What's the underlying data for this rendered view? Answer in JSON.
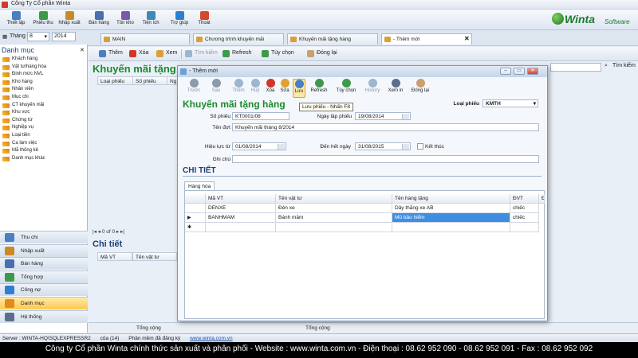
{
  "window": {
    "title": "Công Ty Cổ phần Winta"
  },
  "ribbon": {
    "buttons": [
      {
        "label": "Thiết lập",
        "icon": "settings-icon",
        "color": "#4a7fc1"
      },
      {
        "label": "Phiếu thu",
        "icon": "receipt-icon",
        "color": "#3e9a4a"
      },
      {
        "label": "Nhập xuất",
        "icon": "import-export-icon",
        "color": "#c98a26"
      },
      {
        "label": "Bán hàng",
        "icon": "sales-icon",
        "color": "#4a6fb0"
      },
      {
        "label": "Tồn kho",
        "icon": "warehouse-icon",
        "color": "#7a5aa8"
      },
      {
        "label": "Tiện ích",
        "icon": "utility-icon",
        "color": "#3a8bb8"
      },
      {
        "label": "Trợ giúp",
        "icon": "help-icon",
        "color": "#2f7fd1"
      },
      {
        "label": "Thoát",
        "icon": "exit-icon",
        "color": "#d2492e"
      }
    ],
    "logo": {
      "word": "Winta",
      "suffix": "Software"
    }
  },
  "period": {
    "month_label": "Tháng",
    "month_value": "8",
    "year_value": "2014"
  },
  "tabs": [
    {
      "label": "MAIN"
    },
    {
      "label": "Chương trình khuyến mãi"
    },
    {
      "label": "Khuyến mãi tặng hàng"
    },
    {
      "label": "- Thêm mới"
    }
  ],
  "sidebar": {
    "title": "Danh mục",
    "items": [
      "Khách hàng",
      "Vật tư/hàng hóa",
      "Định mức NVL",
      "Kho hàng",
      "Nhân viên",
      "Mục chi",
      "CT khuyến mãi",
      "Khu vực",
      "Chứng từ",
      "Nghiệp vụ",
      "Loại tiền",
      "Ca làm việc",
      "Mã thống kê",
      "Danh mục khác"
    ],
    "nav": [
      {
        "label": "Thu chi",
        "color": "#4a7fc1"
      },
      {
        "label": "Nhập xuất",
        "color": "#c98a26"
      },
      {
        "label": "Bán hàng",
        "color": "#4a6fb0"
      },
      {
        "label": "Tổng hợp",
        "color": "#3e9a4a"
      },
      {
        "label": "Công nợ",
        "color": "#2f7fd1"
      },
      {
        "label": "Danh mục",
        "color": "#e28a1c",
        "active": true
      },
      {
        "label": "Hệ thống",
        "color": "#5a6f90"
      }
    ]
  },
  "main_toolbar": {
    "add": "Thêm",
    "delete": "Xóa",
    "view": "Xem",
    "search": "Tìm kiếm",
    "refresh": "Refresh",
    "options": "Tùy chọn",
    "close": "Đóng lại"
  },
  "background_form": {
    "title": "Khuyến mãi tặng",
    "columns": [
      "Loại phiếu",
      "Số phiếu",
      "Ng"
    ],
    "pager": "0 of 0",
    "detail_title": "Chi tiết",
    "detail_columns": [
      "Mã VT",
      "Tên vật tư"
    ],
    "search_button": "Tìm kiếm",
    "footer": {
      "total1": "Tổng cộng",
      "total2": "Tổng cộng"
    }
  },
  "dialog": {
    "title": "- Thêm mới",
    "toolbar": [
      {
        "label": "Trước",
        "dim": true,
        "color": "#8d9aab"
      },
      {
        "label": "Sau",
        "dim": true,
        "color": "#8d9aab"
      },
      {
        "label": "Thêm",
        "dim": true,
        "color": "#9db5cf"
      },
      {
        "label": "Huỷ",
        "dim": true,
        "color": "#9db5cf"
      },
      {
        "label": "Xóa",
        "dim": false,
        "color": "#d2352a"
      },
      {
        "label": "Sửa",
        "dim": false,
        "color": "#e0a22e"
      },
      {
        "label": "Lưu",
        "dim": false,
        "color": "#4a7fc1",
        "pressed": true
      },
      {
        "label": "Refresh",
        "dim": false,
        "color": "#3e9a4a"
      },
      {
        "label": "Tùy chọn",
        "dim": false,
        "color": "#3e9a4a"
      },
      {
        "label": "History",
        "dim": true,
        "color": "#9db5cf"
      },
      {
        "label": "Xem in",
        "dim": false,
        "color": "#5a6f90"
      },
      {
        "label": "Đóng lại",
        "dim": false,
        "color": "#c9a070"
      }
    ],
    "tooltip": "Lưu phiếu - Nhấn F8",
    "form_title": "Khuyến mãi tặng hàng",
    "fields": {
      "loai_phieu_label": "Loại phiếu",
      "loai_phieu_value": "KMTH",
      "so_phieu_label": "Số phiếu",
      "so_phieu_value": "KT0001/08",
      "ngay_lap_label": "Ngày lập phiếu",
      "ngay_lap_value": "19/08/2014",
      "ten_dot_label": "Tên đợt",
      "ten_dot_value": "Khuyến mãi tháng 8/2014",
      "hieu_luc_label": "Hiệu lực từ",
      "hieu_luc_value": "01/08/2014",
      "den_het_label": "Đến hết ngày",
      "den_het_value": "31/08/2015",
      "ket_thuc_label": "Kết thúc",
      "ghi_chu_label": "Ghi chú"
    },
    "detail": {
      "section_title": "CHI TIẾT",
      "subtab": "Hàng hóa",
      "columns": [
        "Mã VT",
        "Tên vật tư",
        "Tên hàng tặng",
        "ĐVT",
        "Đ"
      ],
      "rows": [
        {
          "ma_vt": "DENXE",
          "ten_vt": "Đèn xe",
          "hang_tang": "Dây thắng xe AB",
          "dvt": "chiếc"
        },
        {
          "ma_vt": "BANHMAM",
          "ten_vt": "Bánh mâm",
          "hang_tang": "Mũ bảo hiểm",
          "dvt": "chiếc"
        }
      ]
    }
  },
  "status": {
    "server": "Server : WINTA-HQ\\SQLEXPRESSR2",
    "of": "của (14)",
    "license": "Phần mềm đã đăng ký",
    "website": "www.winta.com.vn"
  },
  "banner": "Công ty Cổ phần Winta chính thức sản xuất và phân phối - Website : www.winta.com.vn - Điện thoại : 08.62 952 090 - 08.62 952 091 - Fax : 08.62 952 092"
}
